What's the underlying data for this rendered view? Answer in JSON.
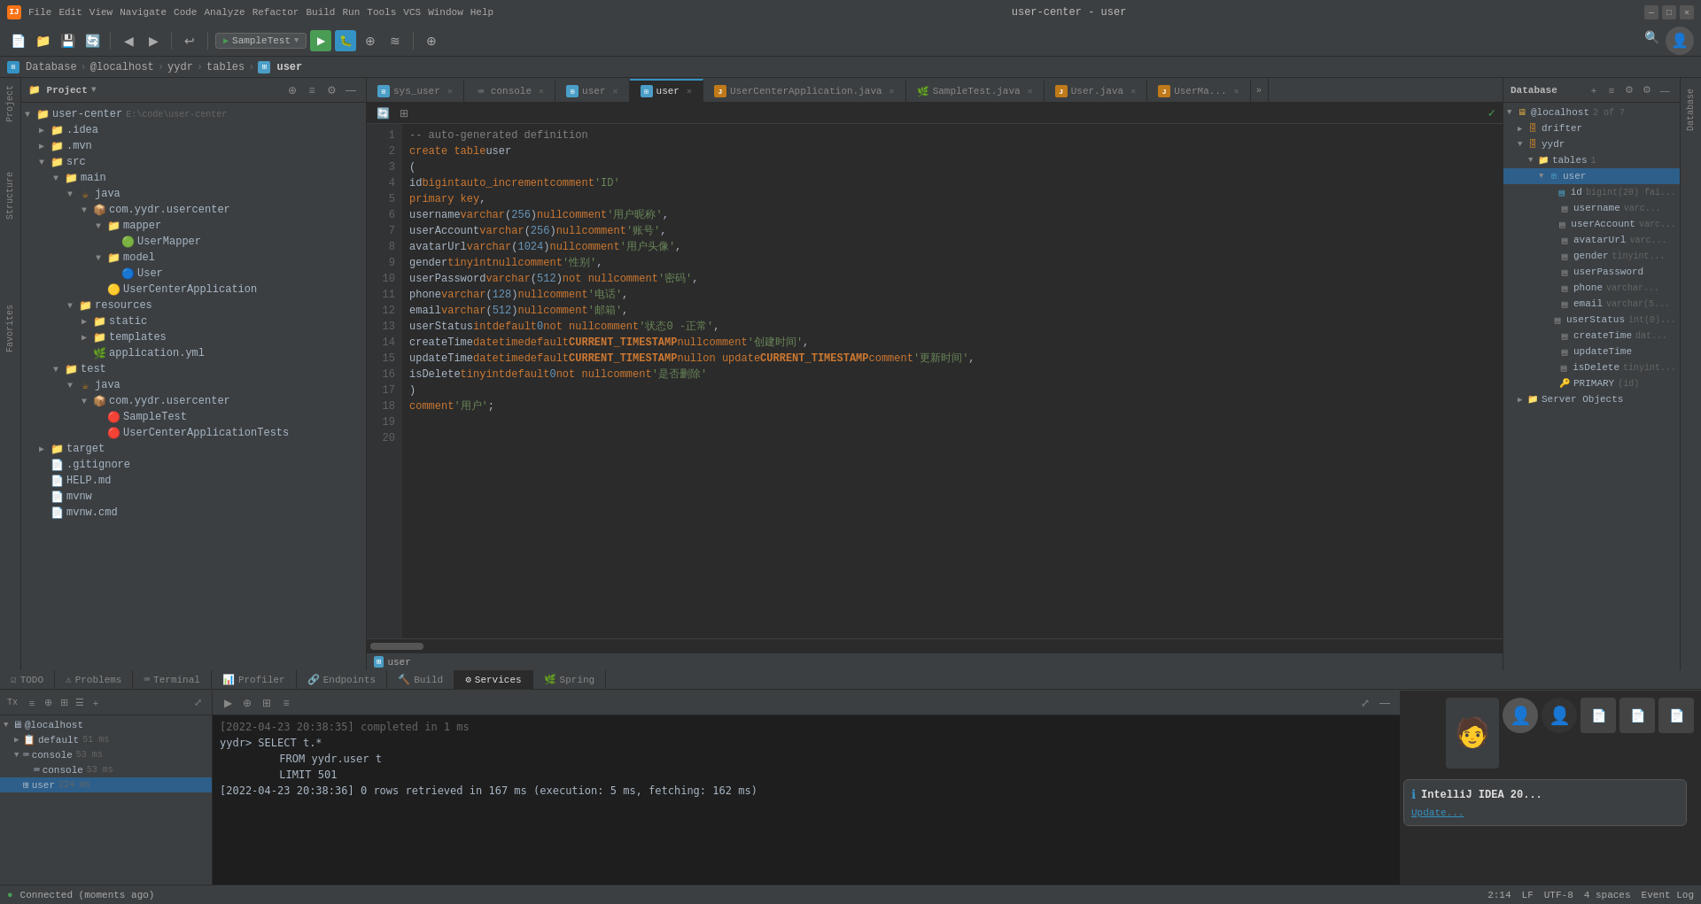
{
  "app": {
    "title": "user-center - user",
    "icon": "IJ"
  },
  "titlebar": {
    "minimize": "—",
    "maximize": "□",
    "close": "✕"
  },
  "menubar": {
    "items": [
      "File",
      "Edit",
      "View",
      "Navigate",
      "Code",
      "Analyze",
      "Refactor",
      "Build",
      "Run",
      "Tools",
      "VCS",
      "Window",
      "Help"
    ]
  },
  "breadcrumb": {
    "items": [
      "Database",
      "@localhost",
      "yydr",
      "tables",
      "user"
    ]
  },
  "sidebar": {
    "title": "Project",
    "root": "user-center",
    "root_path": "E:\\code\\user-center"
  },
  "editor_tabs": [
    {
      "id": "sys_user",
      "label": "sys_user",
      "type": "db",
      "active": false
    },
    {
      "id": "console",
      "label": "console",
      "type": "console",
      "active": false
    },
    {
      "id": "user1",
      "label": "user",
      "type": "db",
      "active": false
    },
    {
      "id": "user2",
      "label": "user",
      "type": "db",
      "active": true
    },
    {
      "id": "UserCenterApplication",
      "label": "UserCenterApplication.java",
      "type": "java",
      "active": false
    },
    {
      "id": "SampleTest",
      "label": "SampleTest.java",
      "type": "java",
      "active": false
    },
    {
      "id": "UserJava",
      "label": "User.java",
      "type": "java",
      "active": false
    },
    {
      "id": "UserMa",
      "label": "UserMa...",
      "type": "java",
      "active": false
    }
  ],
  "code": {
    "lines": [
      {
        "num": 1,
        "content": "-- auto-generated definition"
      },
      {
        "num": 2,
        "content": "create table user"
      },
      {
        "num": 3,
        "content": "("
      },
      {
        "num": 4,
        "content": "    id              bigint auto_increment comment 'ID'"
      },
      {
        "num": 5,
        "content": "        primary key,"
      },
      {
        "num": 6,
        "content": "    username         varchar(256)                       null comment '用户昵称',"
      },
      {
        "num": 7,
        "content": "    userAccount       varchar(256)                       null comment '账号',"
      },
      {
        "num": 8,
        "content": "    avatarUrl         varchar(1024)                      null comment '用户头像',"
      },
      {
        "num": 9,
        "content": "    gender            tinyint                            null comment '性别',"
      },
      {
        "num": 10,
        "content": "    userPassword      varchar(512)                       not null comment '密码',"
      },
      {
        "num": 11,
        "content": "    phone             varchar(128)                       null comment '电话',"
      },
      {
        "num": 12,
        "content": "    email             varchar(512)                       null comment '邮箱',"
      },
      {
        "num": 13,
        "content": "    userStatus        int          default 0             not null comment '状态0 -正常',"
      },
      {
        "num": 14,
        "content": "    createTime        datetime     default CURRENT_TIMESTAMP null comment '创建时间',"
      },
      {
        "num": 15,
        "content": "    updateTime        datetime     default CURRENT_TIMESTAMP null on update CURRENT_TIMESTAMP comment '更新时间',"
      },
      {
        "num": 16,
        "content": "    isDelete          tinyint      default 0             not null comment '是否删除'"
      },
      {
        "num": 17,
        "content": ")"
      },
      {
        "num": 18,
        "content": "    comment '用户';"
      },
      {
        "num": 19,
        "content": ""
      },
      {
        "num": 20,
        "content": ""
      }
    ]
  },
  "database_panel": {
    "title": "Database",
    "host": "@localhost",
    "host_count": "2 of 7",
    "nodes": [
      {
        "id": "drifter",
        "label": "drifter",
        "type": "schema",
        "level": 1,
        "expanded": false
      },
      {
        "id": "yydr",
        "label": "yydr",
        "type": "schema",
        "level": 1,
        "expanded": true
      },
      {
        "id": "tables",
        "label": "tables",
        "type": "folder",
        "level": 2,
        "expanded": true,
        "count": "1"
      },
      {
        "id": "user_table",
        "label": "user",
        "type": "table",
        "level": 3,
        "expanded": true,
        "selected": true
      },
      {
        "id": "col_id",
        "label": "id",
        "type": "column",
        "level": 4,
        "detail": "bigint(20) fai..."
      },
      {
        "id": "col_username",
        "label": "username",
        "type": "column",
        "level": 4,
        "detail": "varc..."
      },
      {
        "id": "col_userAccount",
        "label": "userAccount",
        "type": "column",
        "level": 4,
        "detail": "varc..."
      },
      {
        "id": "col_avatarUrl",
        "label": "avatarUrl",
        "type": "column",
        "level": 4,
        "detail": "varc..."
      },
      {
        "id": "col_gender",
        "label": "gender",
        "type": "column",
        "level": 4,
        "detail": "tinyint..."
      },
      {
        "id": "col_userPassword",
        "label": "userPassword",
        "type": "column",
        "level": 4
      },
      {
        "id": "col_phone",
        "label": "phone",
        "type": "column",
        "level": 4,
        "detail": "varchar..."
      },
      {
        "id": "col_email",
        "label": "email",
        "type": "column",
        "level": 4,
        "detail": "varchar(5..."
      },
      {
        "id": "col_userStatus",
        "label": "userStatus",
        "type": "column",
        "level": 4,
        "detail": "int(0)..."
      },
      {
        "id": "col_createTime",
        "label": "createTime",
        "type": "column",
        "level": 4,
        "detail": "dat..."
      },
      {
        "id": "col_updateTime",
        "label": "updateTime",
        "type": "column",
        "level": 4
      },
      {
        "id": "col_isDelete",
        "label": "isDelete",
        "type": "column",
        "level": 4,
        "detail": "tinyint..."
      },
      {
        "id": "primary_key",
        "label": "PRIMARY",
        "type": "key",
        "level": 4,
        "detail": "(id)"
      },
      {
        "id": "server_objects",
        "label": "Server Objects",
        "type": "folder",
        "level": 1,
        "expanded": false
      }
    ]
  },
  "console": {
    "lines": [
      {
        "text": "[2022-04-23 20:38:35] completed in 1 ms",
        "type": "dim"
      },
      {
        "text": "yydr> SELECT t.*",
        "type": "result"
      },
      {
        "text": "      FROM yydr.user t",
        "type": "sql"
      },
      {
        "text": "      LIMIT 501",
        "type": "sql"
      },
      {
        "text": "[2022-04-23 20:38:36] 0 rows retrieved in 167 ms (execution: 5 ms, fetching: 162 ms)",
        "type": "result"
      }
    ]
  },
  "services": {
    "tabs": [
      "Tx",
      ""
    ],
    "nodes": [
      {
        "label": "@localhost",
        "level": 0,
        "expanded": true
      },
      {
        "label": "default",
        "level": 1,
        "detail": "51 ms",
        "expanded": false
      },
      {
        "label": "console",
        "level": 1,
        "detail": "53 ms",
        "expanded": true
      },
      {
        "label": "console",
        "level": 2,
        "detail": "53 ms"
      },
      {
        "label": "user",
        "level": 1,
        "detail": "224 ms",
        "selected": true
      }
    ]
  },
  "bottom_tabs": [
    "TODO",
    "Problems",
    "Terminal",
    "Profiler",
    "Endpoints",
    "Build",
    "Services",
    "Spring"
  ],
  "active_bottom_tab": "Services",
  "statusbar": {
    "connection": "Connected (moments ago)",
    "position": "2:14",
    "line_ending": "LF",
    "encoding": "UTF-8",
    "indent": "4 spaces",
    "event_log": "Event Log"
  },
  "notification": {
    "title": "IntelliJ IDEA 20...",
    "body": "Update...",
    "icon": "ℹ"
  },
  "run_config": "SampleTest"
}
